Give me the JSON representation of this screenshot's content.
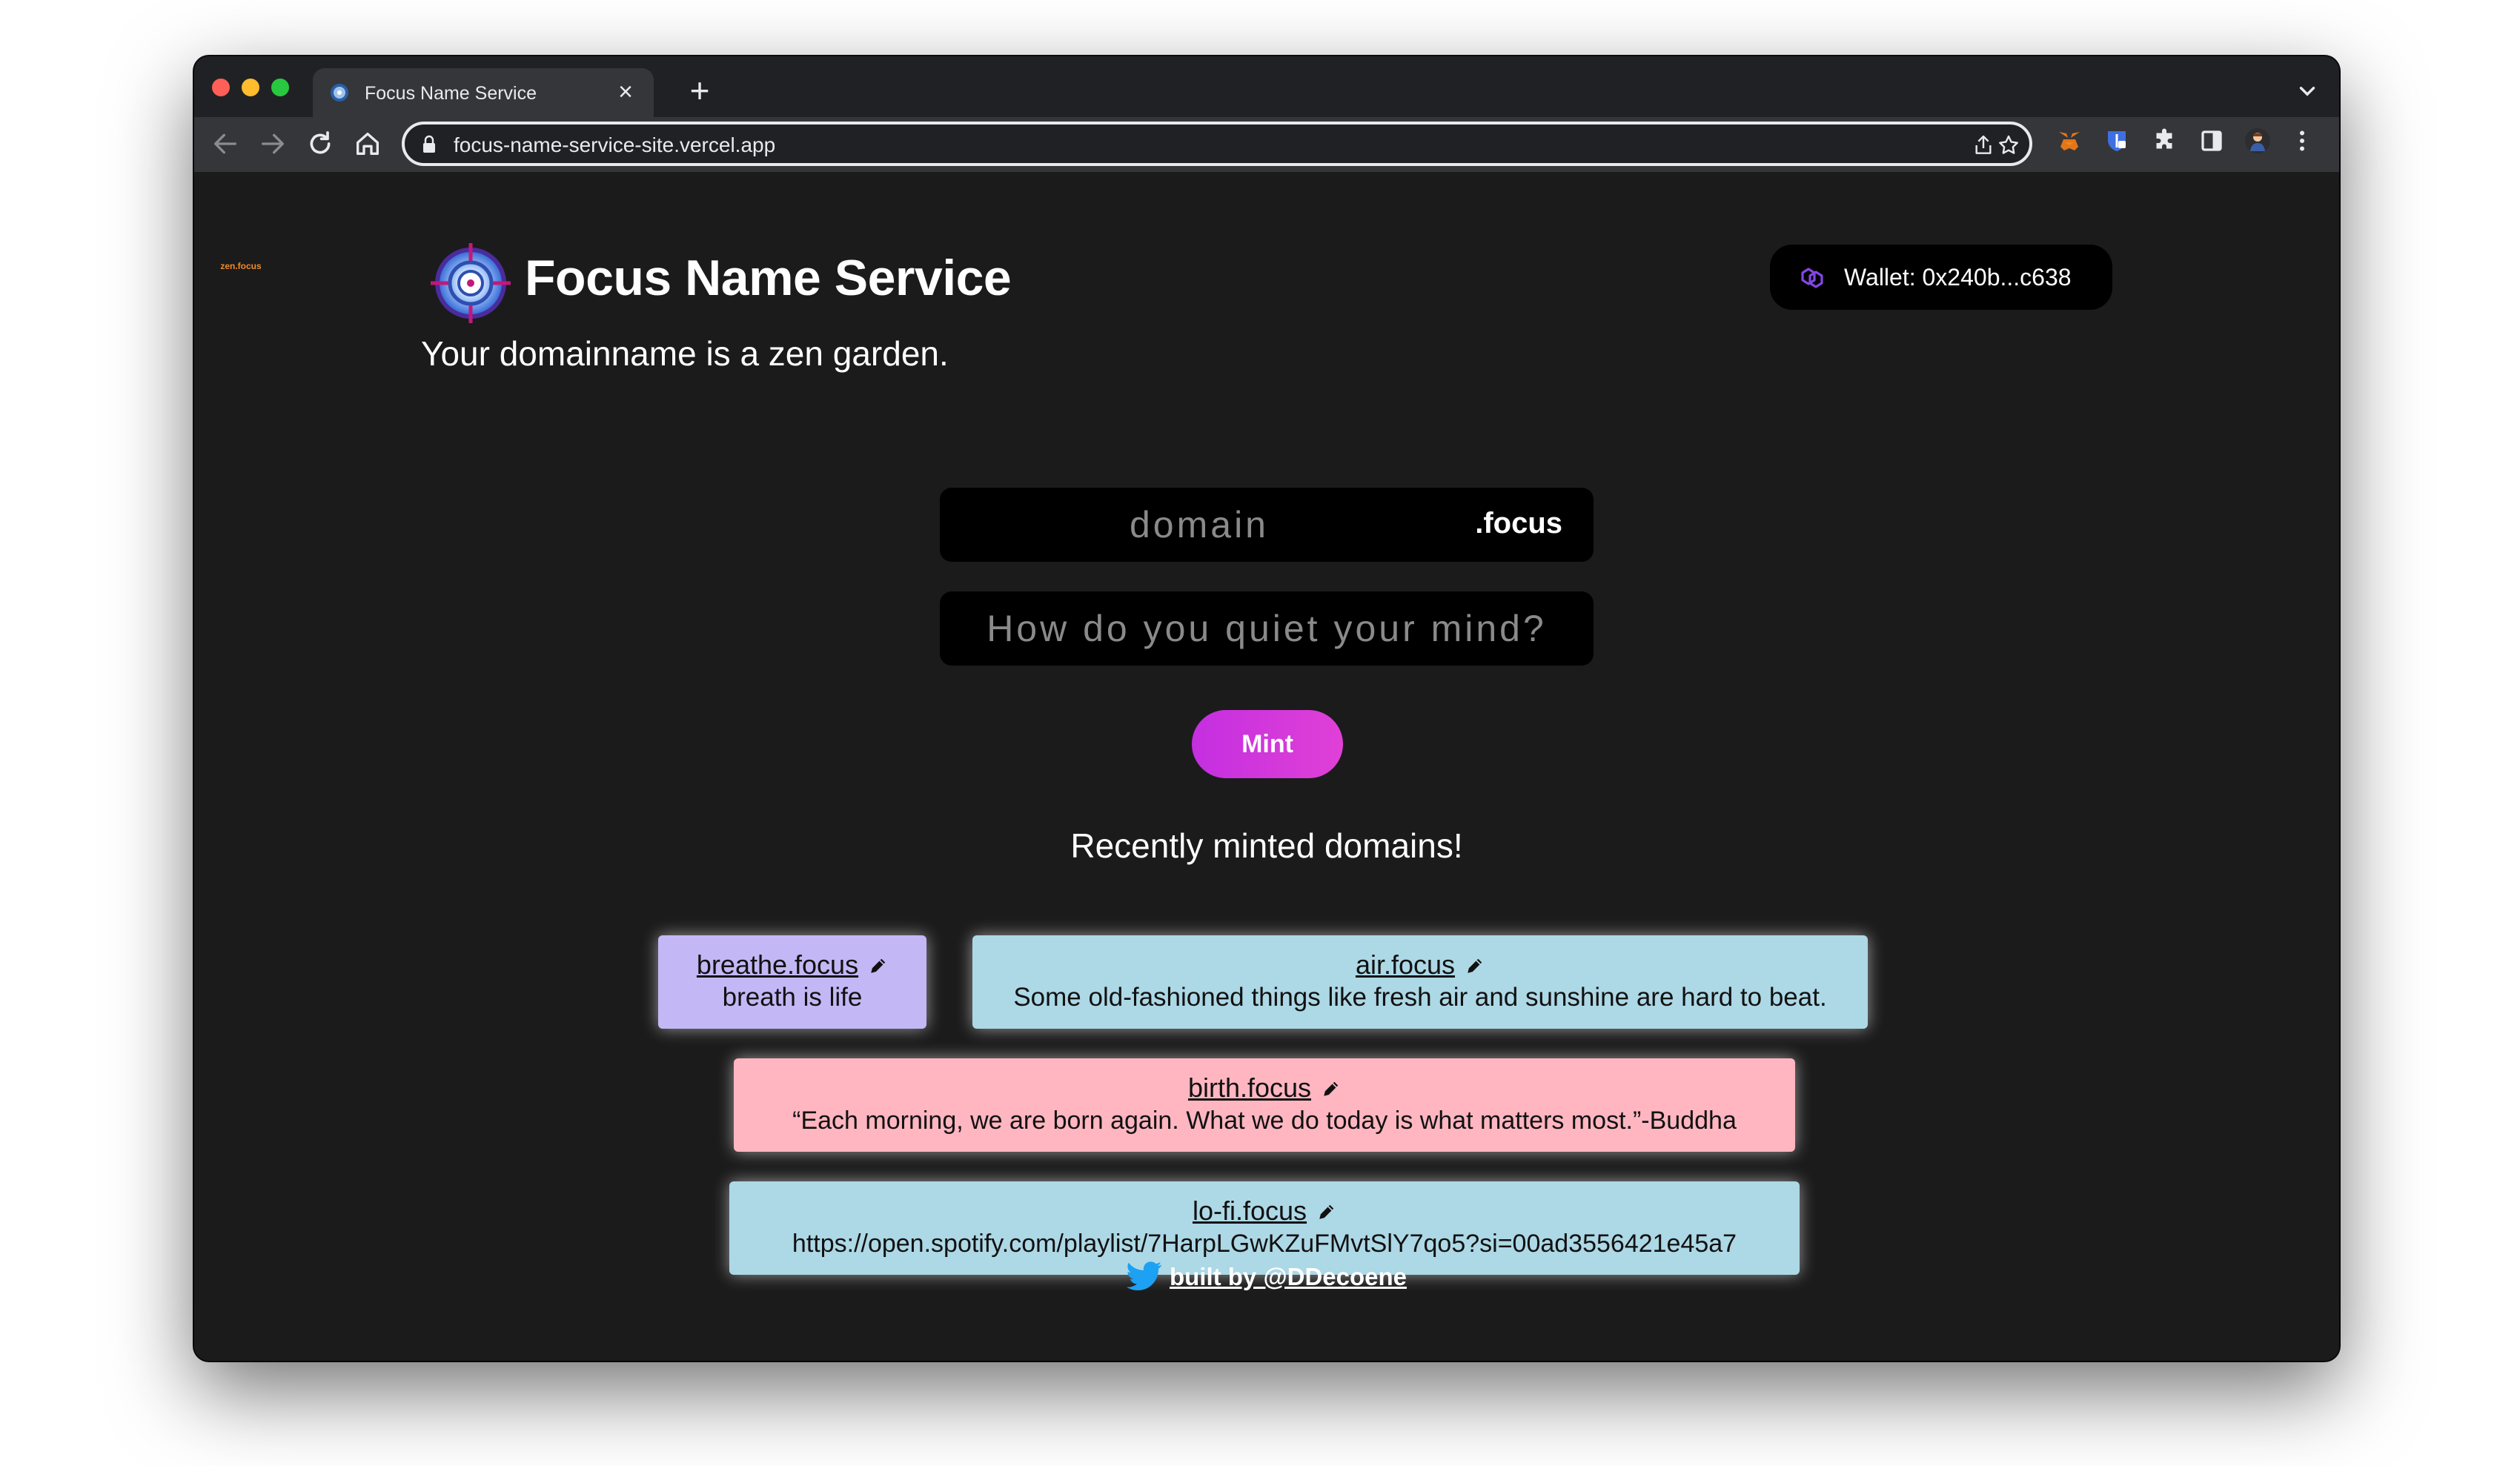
{
  "browser": {
    "tab_title": "Focus Name Service",
    "url": "focus-name-service-site.vercel.app"
  },
  "header": {
    "logo_label": "zen.focus",
    "brand": "Focus Name Service",
    "tagline": "Your domainname is a zen garden.",
    "wallet": "Wallet: 0x240b...c638"
  },
  "form": {
    "domain_placeholder": "domain",
    "tld": ".focus",
    "record_placeholder": "How do you quiet your mind?",
    "mint_label": "Mint"
  },
  "recent": {
    "title": "Recently minted domains!",
    "cards": [
      {
        "name": "breathe.focus",
        "record": "breath is life",
        "color": "#c3b8f5"
      },
      {
        "name": "air.focus",
        "record": "Some old-fashioned things like fresh air and sunshine are hard to beat.",
        "color": "#add8e6"
      },
      {
        "name": "birth.focus",
        "record": "“Each morning, we are born again. What we do today is what matters most.”-Buddha",
        "color": "#ffb6c1"
      },
      {
        "name": "lo-fi.focus",
        "record": "https://open.spotify.com/playlist/7HarpLGwKZuFMvtSlY7qo5?si=00ad3556421e45a7",
        "color": "#add8e6"
      }
    ]
  },
  "footer": {
    "credit": "built by @DDecoene"
  },
  "colors": {
    "page_bg": "#1b1b1c",
    "mint_gradient_start": "#c42fe0",
    "mint_gradient_end": "#e040d6",
    "wallet_icon": "#8247e5"
  }
}
